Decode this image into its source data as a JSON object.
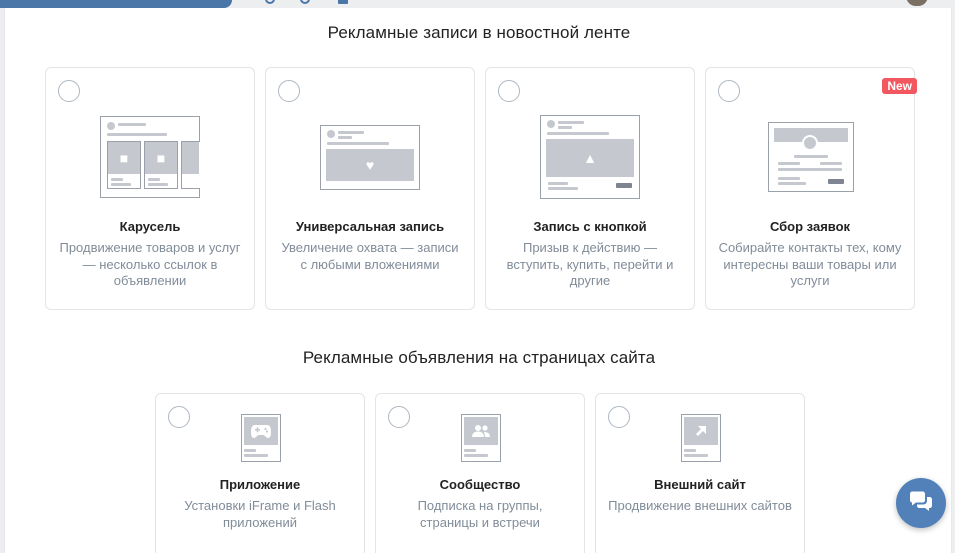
{
  "section_feed": {
    "title": "Рекламные записи в новостной ленте",
    "cards": [
      {
        "title": "Карусель",
        "desc": "Продвижение товаров и услуг — несколько ссылок в объявлении"
      },
      {
        "title": "Универсальная запись",
        "desc": "Увеличение охвата — записи с любыми вложениями"
      },
      {
        "title": "Запись с кнопкой",
        "desc": "Призыв к действию — вступить, купить, перейти и другие"
      },
      {
        "title": "Сбор заявок",
        "desc": "Собирайте контакты тех, кому интересны ваши товары или услуги",
        "badge": "New"
      }
    ]
  },
  "section_site": {
    "title": "Рекламные объявления на страницах сайта",
    "cards": [
      {
        "title": "Приложение",
        "desc": "Установки iFrame и Flash приложений"
      },
      {
        "title": "Сообщество",
        "desc": "Подписка на группы, страницы и встречи"
      },
      {
        "title": "Внешний сайт",
        "desc": "Продвижение внешних сайтов"
      }
    ]
  },
  "icons": {
    "carousel": "carousel-illustration",
    "universal": "universal-post-illustration",
    "button_post": "button-post-illustration",
    "lead_form": "lead-form-illustration",
    "app": "gamepad-icon",
    "community": "people-icon",
    "external": "arrow-link-icon",
    "chat": "chat-bubbles-icon"
  },
  "colors": {
    "accent": "#5181b8",
    "badge": "#f2565e",
    "desc": "#818c99"
  }
}
